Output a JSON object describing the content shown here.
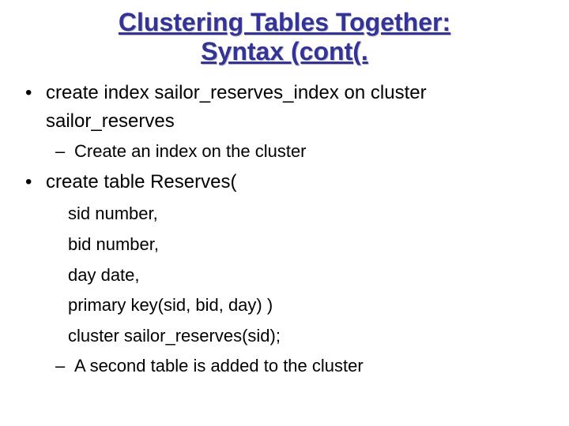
{
  "title_line1": "Clustering Tables Together:",
  "title_line2": "Syntax (cont(.",
  "b1": {
    "dot": "•",
    "line1": "create index sailor_reserves_index on cluster",
    "line2": "sailor_reserves",
    "sub_dash": "–",
    "sub_text": "Create an index on the cluster"
  },
  "b2": {
    "dot": "•",
    "line1": "create table Reserves(",
    "code1": "sid number,",
    "code2": "bid number,",
    "code3": "day date,",
    "code4": "primary key(sid, bid, day) )",
    "code5": "cluster sailor_reserves(sid);",
    "sub_dash": "–",
    "sub_text": "A second table is added to the cluster"
  }
}
